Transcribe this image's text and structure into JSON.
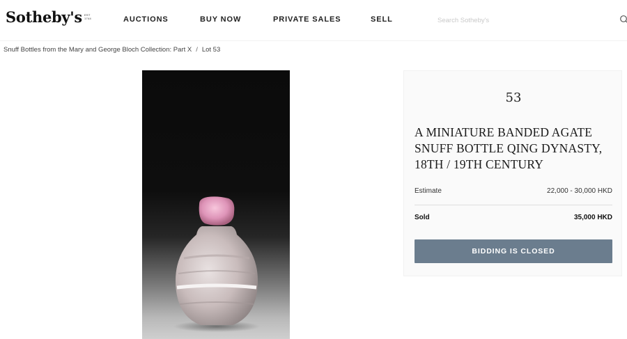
{
  "header": {
    "logo_text": "Sotheby's",
    "logo_est": "EST 1744",
    "nav": [
      "AUCTIONS",
      "BUY NOW",
      "PRIVATE SALES",
      "SELL"
    ],
    "search_placeholder": "Search Sotheby's",
    "search_icon": "search-icon"
  },
  "breadcrumb": {
    "sale": "Snuff Bottles from the Mary and George Bloch Collection: Part X",
    "separator": "/",
    "lot": "Lot 53"
  },
  "lot": {
    "number": "53",
    "title": "A MINIATURE BANDED AGATE SNUFF BOTTLE QING DYNASTY, 18TH / 19TH CENTURY",
    "estimate_label": "Estimate",
    "estimate_value": "22,000 - 30,000 HKD",
    "sold_label": "Sold",
    "sold_value": "35,000 HKD",
    "button_label": "BIDDING IS CLOSED"
  },
  "colors": {
    "button": "#6b7d8e",
    "panel_bg": "#fafafa"
  }
}
